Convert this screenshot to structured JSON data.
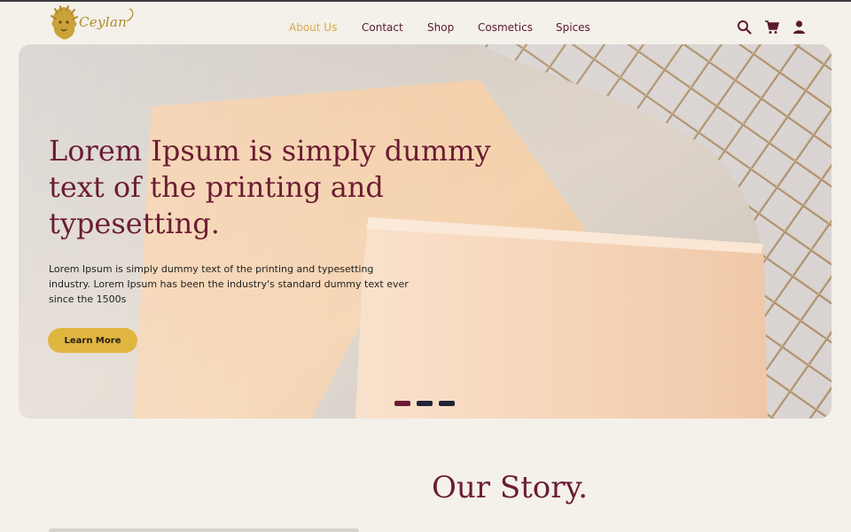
{
  "brand": {
    "name": "Ceylan",
    "color": "#b08a2a"
  },
  "nav": {
    "items": [
      {
        "label": "About Us",
        "active": true
      },
      {
        "label": "Contact",
        "active": false
      },
      {
        "label": "Shop",
        "active": false
      },
      {
        "label": "Cosmetics",
        "active": false
      },
      {
        "label": "Spices",
        "active": false
      }
    ],
    "icons": [
      "search-icon",
      "cart-icon",
      "user-icon"
    ]
  },
  "hero": {
    "title": "Lorem Ipsum is simply dummy text of the printing and typesetting.",
    "body": "Lorem Ipsum is simply dummy text of the printing and  typesetting industry. Lorem Ipsum has been the industry's standard dummy  text ever since the 1500s",
    "button_label": "Learn More",
    "slides": 3,
    "active_slide": 1
  },
  "story": {
    "title": "Our Story."
  },
  "colors": {
    "background": "#f4f0ea",
    "maroon": "#6b1c33",
    "gold": "#e0b641",
    "nav_active": "#d6a94a",
    "dot_inactive": "#1f2537"
  }
}
